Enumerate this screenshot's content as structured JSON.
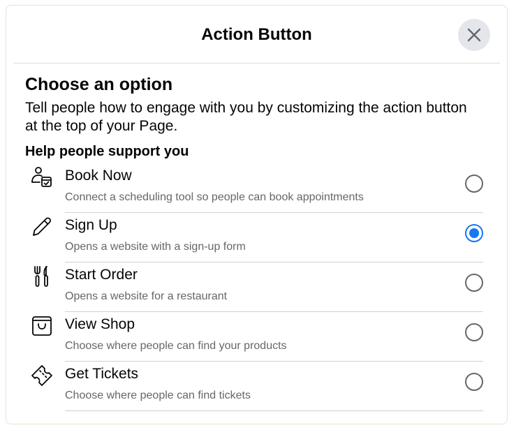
{
  "dialog": {
    "title": "Action Button",
    "close_icon": "close-icon"
  },
  "content": {
    "title": "Choose an option",
    "description": "Tell people how to engage with you by customizing the action button at the top of your Page.",
    "group_title": "Help people support you"
  },
  "options": [
    {
      "label": "Book Now",
      "description": "Connect a scheduling tool so people can book appointments",
      "icon": "calendar-person-icon",
      "selected": false
    },
    {
      "label": "Sign Up",
      "description": "Opens a website with a sign-up form",
      "icon": "pencil-icon",
      "selected": true
    },
    {
      "label": "Start Order",
      "description": "Opens a website for a restaurant",
      "icon": "fork-knife-icon",
      "selected": false
    },
    {
      "label": "View Shop",
      "description": "Choose where people can find your products",
      "icon": "shopping-bag-icon",
      "selected": false
    },
    {
      "label": "Get Tickets",
      "description": "Choose where people can find tickets",
      "icon": "ticket-icon",
      "selected": false
    }
  ],
  "colors": {
    "accent": "#1877f2",
    "secondary_text": "#65676b",
    "close_button_bg": "#e4e6eb"
  }
}
